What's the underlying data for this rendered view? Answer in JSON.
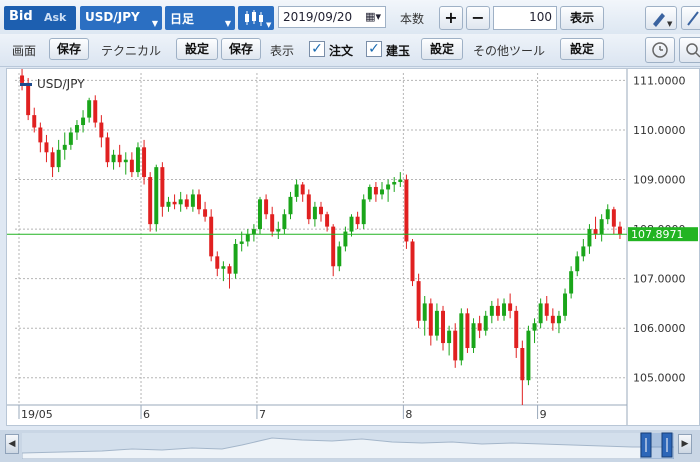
{
  "toolbar": {
    "bid": "Bid",
    "ask": "Ask",
    "pair": "USD/JPY",
    "period": "日足",
    "date": "2019/09/20",
    "count_label": "本数",
    "plus": "+",
    "minus": "−",
    "count": "100",
    "show_button": "表示"
  },
  "toolbar2": {
    "screen_label": "画面",
    "save": "保存",
    "technical_label": "テクニカル",
    "settings": "設定",
    "display_label": "表示",
    "orders": "注文",
    "positions": "建玉",
    "orders_checked": true,
    "positions_checked": true,
    "other_tools_label": "その他ツール"
  },
  "chart_data": {
    "type": "candlestick",
    "legend": "USD/JPY",
    "y_ticks": [
      "111.0000",
      "110.0000",
      "109.0000",
      "108.0000",
      "107.0000",
      "106.0000",
      "105.0000"
    ],
    "ylim": [
      104.45,
      111.15
    ],
    "x_ticks": [
      "19/05",
      "6",
      "7",
      "8",
      "9"
    ],
    "x_tick_index": [
      0,
      20,
      39,
      63,
      85
    ],
    "current_price": "107.8971",
    "current_value": 107.8971,
    "up_color": "#1aa51a",
    "down_color": "#e02020",
    "candles": [
      [
        111.1,
        111.25,
        110.8,
        110.95
      ],
      [
        110.95,
        111.05,
        110.2,
        110.3
      ],
      [
        110.3,
        110.45,
        109.95,
        110.05
      ],
      [
        110.05,
        110.15,
        109.55,
        109.75
      ],
      [
        109.75,
        109.9,
        109.35,
        109.55
      ],
      [
        109.55,
        109.65,
        109.05,
        109.25
      ],
      [
        109.25,
        109.8,
        109.15,
        109.6
      ],
      [
        109.6,
        109.95,
        109.4,
        109.7
      ],
      [
        109.7,
        110.05,
        109.6,
        109.95
      ],
      [
        109.95,
        110.2,
        109.8,
        110.1
      ],
      [
        110.1,
        110.4,
        109.95,
        110.25
      ],
      [
        110.25,
        110.65,
        110.15,
        110.6
      ],
      [
        110.6,
        110.7,
        110.05,
        110.15
      ],
      [
        110.15,
        110.3,
        109.65,
        109.85
      ],
      [
        109.85,
        109.95,
        109.25,
        109.35
      ],
      [
        109.35,
        109.6,
        109.2,
        109.5
      ],
      [
        109.5,
        109.7,
        109.25,
        109.35
      ],
      [
        109.35,
        109.55,
        109.1,
        109.4
      ],
      [
        109.4,
        109.55,
        109.05,
        109.15
      ],
      [
        109.15,
        109.75,
        109.05,
        109.65
      ],
      [
        109.65,
        109.8,
        108.9,
        109.05
      ],
      [
        109.05,
        109.15,
        107.95,
        108.1
      ],
      [
        108.1,
        109.3,
        107.95,
        109.25
      ],
      [
        109.25,
        109.35,
        108.25,
        108.45
      ],
      [
        108.45,
        108.65,
        108.35,
        108.55
      ],
      [
        108.55,
        108.7,
        108.4,
        108.5
      ],
      [
        108.5,
        108.75,
        108.35,
        108.6
      ],
      [
        108.6,
        108.7,
        108.4,
        108.45
      ],
      [
        108.45,
        108.8,
        108.35,
        108.7
      ],
      [
        108.7,
        108.8,
        108.3,
        108.4
      ],
      [
        108.4,
        108.55,
        108.15,
        108.25
      ],
      [
        108.25,
        108.4,
        107.35,
        107.45
      ],
      [
        107.45,
        107.55,
        107.05,
        107.2
      ],
      [
        107.2,
        107.35,
        106.95,
        107.25
      ],
      [
        107.25,
        107.3,
        106.8,
        107.1
      ],
      [
        107.1,
        107.8,
        107.0,
        107.7
      ],
      [
        107.7,
        107.95,
        107.55,
        107.75
      ],
      [
        107.75,
        108.0,
        107.65,
        107.9
      ],
      [
        107.9,
        108.1,
        107.75,
        108.0
      ],
      [
        108.0,
        108.65,
        107.9,
        108.6
      ],
      [
        108.6,
        108.7,
        108.2,
        108.3
      ],
      [
        108.3,
        108.45,
        107.85,
        107.95
      ],
      [
        107.95,
        108.15,
        107.8,
        108.0
      ],
      [
        108.0,
        108.4,
        107.9,
        108.3
      ],
      [
        108.3,
        108.75,
        108.2,
        108.65
      ],
      [
        108.65,
        109.0,
        108.55,
        108.9
      ],
      [
        108.9,
        108.95,
        108.55,
        108.7
      ],
      [
        108.7,
        108.8,
        108.1,
        108.2
      ],
      [
        108.2,
        108.55,
        108.05,
        108.45
      ],
      [
        108.45,
        108.55,
        108.15,
        108.3
      ],
      [
        108.3,
        108.35,
        107.95,
        108.05
      ],
      [
        108.05,
        108.1,
        107.05,
        107.25
      ],
      [
        107.25,
        107.75,
        107.15,
        107.65
      ],
      [
        107.65,
        108.05,
        107.55,
        107.95
      ],
      [
        107.95,
        108.3,
        107.85,
        108.25
      ],
      [
        108.25,
        108.35,
        108.0,
        108.1
      ],
      [
        108.1,
        108.7,
        108.0,
        108.6
      ],
      [
        108.6,
        108.9,
        108.55,
        108.85
      ],
      [
        108.85,
        108.95,
        108.55,
        108.7
      ],
      [
        108.7,
        108.95,
        108.6,
        108.8
      ],
      [
        108.8,
        109.0,
        108.55,
        108.9
      ],
      [
        108.9,
        109.05,
        108.75,
        108.95
      ],
      [
        108.95,
        109.15,
        108.85,
        109.0
      ],
      [
        109.0,
        109.1,
        107.6,
        107.75
      ],
      [
        107.75,
        107.8,
        106.85,
        106.95
      ],
      [
        106.95,
        107.1,
        106.0,
        106.15
      ],
      [
        106.15,
        106.65,
        105.85,
        106.5
      ],
      [
        106.5,
        106.6,
        105.65,
        105.85
      ],
      [
        105.85,
        106.5,
        105.75,
        106.35
      ],
      [
        106.35,
        106.45,
        105.55,
        105.7
      ],
      [
        105.7,
        106.05,
        105.45,
        105.95
      ],
      [
        105.95,
        106.1,
        105.2,
        105.35
      ],
      [
        105.35,
        106.4,
        105.25,
        106.3
      ],
      [
        106.3,
        106.4,
        105.5,
        105.6
      ],
      [
        105.6,
        106.2,
        105.5,
        106.1
      ],
      [
        106.1,
        106.25,
        105.8,
        105.95
      ],
      [
        105.95,
        106.35,
        105.85,
        106.25
      ],
      [
        106.25,
        106.55,
        106.1,
        106.45
      ],
      [
        106.45,
        106.6,
        106.15,
        106.25
      ],
      [
        106.25,
        106.6,
        106.15,
        106.5
      ],
      [
        106.5,
        106.7,
        106.2,
        106.35
      ],
      [
        106.35,
        106.45,
        105.4,
        105.6
      ],
      [
        105.6,
        105.75,
        104.45,
        104.95
      ],
      [
        104.95,
        106.05,
        104.85,
        105.95
      ],
      [
        105.95,
        106.2,
        105.7,
        106.1
      ],
      [
        106.1,
        106.6,
        106.0,
        106.5
      ],
      [
        106.5,
        106.65,
        106.15,
        106.25
      ],
      [
        106.25,
        106.4,
        105.95,
        106.1
      ],
      [
        106.1,
        106.35,
        105.9,
        106.25
      ],
      [
        106.25,
        106.8,
        106.15,
        106.7
      ],
      [
        106.7,
        107.25,
        106.6,
        107.15
      ],
      [
        107.15,
        107.55,
        107.05,
        107.45
      ],
      [
        107.45,
        107.8,
        107.35,
        107.65
      ],
      [
        107.65,
        108.1,
        107.5,
        108.0
      ],
      [
        108.0,
        108.25,
        107.8,
        107.9
      ],
      [
        107.9,
        108.3,
        107.75,
        108.2
      ],
      [
        108.2,
        108.5,
        108.1,
        108.4
      ],
      [
        108.4,
        108.45,
        107.9,
        108.05
      ],
      [
        108.05,
        108.15,
        107.8,
        107.9
      ]
    ]
  },
  "scroll": {
    "left_arrow": "◀",
    "right_arrow": "▶"
  }
}
